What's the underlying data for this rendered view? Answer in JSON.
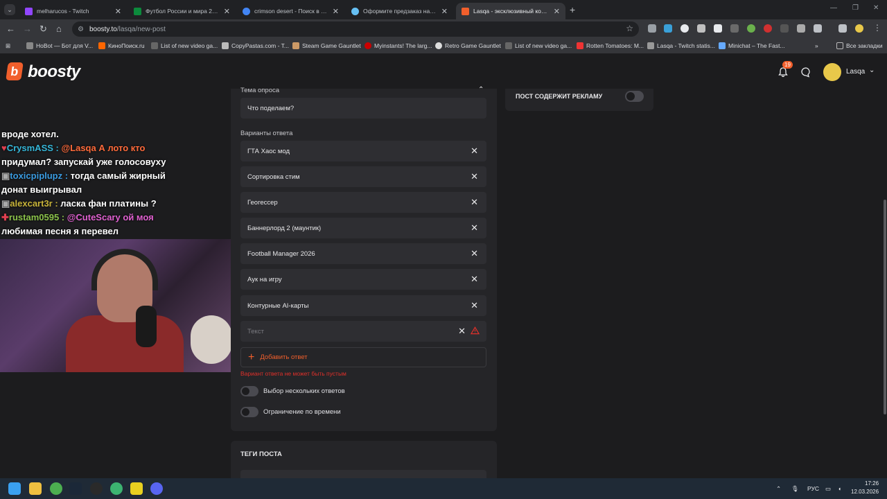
{
  "browser": {
    "tabs": [
      {
        "title": "melharucos - Twitch",
        "color": "#9146ff"
      },
      {
        "title": "Футбол России и мира 2026 -",
        "color": "#0c8a3c"
      },
      {
        "title": "crimson desert - Поиск в Goog",
        "color": "#4285f4"
      },
      {
        "title": "Оформите предзаказ на Crim",
        "color": "#1b2838"
      },
      {
        "title": "Lasqa - эксклюзивный контен",
        "color": "#f15f2c"
      }
    ],
    "url_host": "boosty.to",
    "url_path": "/lasqa/new-post",
    "bookmarks": [
      "HoBot — Бот для V...",
      "КиноПоиск.ru",
      "List of new video ga...",
      "CopyPastas.com - T...",
      "Steam Game Gauntlet",
      "Myinstants! The larg...",
      "Retro Game Gauntlet",
      "List of new video ga...",
      "Rotten Tomatoes: M...",
      "Lasqa - Twitch statis...",
      "Minichat – The Fast..."
    ],
    "all_bookmarks": "Все закладки"
  },
  "site": {
    "logo": "boosty",
    "notif_count": "19",
    "username": "Lasqa"
  },
  "stream_chat": [
    {
      "nick": "",
      "nick_color": "#ffffff",
      "text": "вроде хотел."
    },
    {
      "nick": "CrysmASS :",
      "nick_color": "#35b6d8",
      "text": " @Lasqa А лото кто"
    },
    {
      "nick": "",
      "nick_color": "#ffffff",
      "text": "придумал? запускай уже голосовуху"
    },
    {
      "nick": "toxicpiplupz :",
      "nick_color": "#3a9be0",
      "text": " тогда самый жирный"
    },
    {
      "nick": "",
      "nick_color": "#ffffff",
      "text": "донат выигрывал"
    },
    {
      "nick": "alexcart3r :",
      "nick_color": "#c8b43a",
      "text": " ласка фан платины ?"
    },
    {
      "nick": "rustam0595 :",
      "nick_color": "#8bc34a",
      "text": " @CuteScary ой моя"
    },
    {
      "nick": "",
      "nick_color": "#ffffff",
      "text": "любимая песня я перевел"
    }
  ],
  "poll": {
    "topic_label": "Тема опроса",
    "topic_value": "Что поделаем?",
    "answers_label": "Варианты ответа",
    "answers": [
      "ГТА Хаос мод",
      "Сортировка стим",
      "Геогессер",
      "Баннерлорд 2 (маунтик)",
      "Football Manager 2026",
      "Аук на игру",
      "Контурные AI-карты"
    ],
    "new_answer_placeholder": "Текст",
    "add_answer": "Добавить ответ",
    "error": "Вариант ответа не может быть пустым",
    "multi_choice": "Выбор нескольких ответов",
    "time_limit": "Ограничение по времени"
  },
  "tags_title": "ТЕГИ ПОСТА",
  "ad_label": "ПОСТ СОДЕРЖИТ РЕКЛАМУ",
  "taskbar": {
    "lang": "РУС",
    "time": "17:26",
    "date": "12.03.2026"
  }
}
